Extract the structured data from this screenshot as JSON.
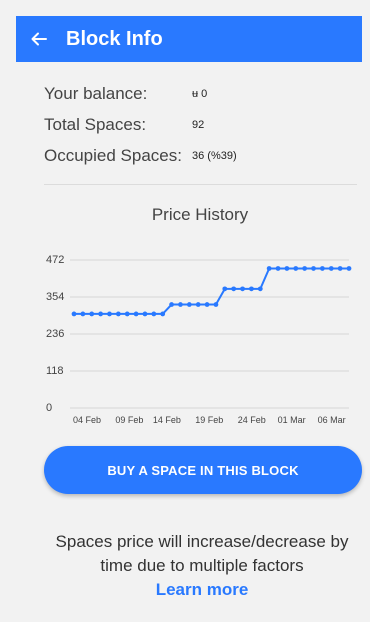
{
  "header": {
    "title": "Block Info",
    "back_icon": "arrow-left-icon"
  },
  "info": {
    "balance_label": "Your balance:",
    "balance_value": "ʉ 0",
    "total_label": "Total Spaces:",
    "total_value": "92",
    "occupied_label": "Occupied Spaces:",
    "occupied_value": "36 (%39)"
  },
  "chart_title": "Price History",
  "chart_data": {
    "type": "line",
    "ylim": [
      0,
      472
    ],
    "yticks": [
      0,
      118,
      236,
      354,
      472
    ],
    "xtick_labels": [
      "04 Feb",
      "09 Feb",
      "14 Feb",
      "19 Feb",
      "24 Feb",
      "01 Mar",
      "06 Mar"
    ],
    "x": [
      0,
      1,
      2,
      3,
      4,
      5,
      6,
      7,
      8,
      9,
      10,
      11,
      12,
      13,
      14,
      15,
      16,
      17,
      18,
      19,
      20,
      21,
      22,
      23,
      24,
      25,
      26,
      27,
      28,
      29,
      30,
      31
    ],
    "values": [
      300,
      300,
      300,
      300,
      300,
      300,
      300,
      300,
      300,
      300,
      300,
      330,
      330,
      330,
      330,
      330,
      330,
      380,
      380,
      380,
      380,
      380,
      445,
      445,
      445,
      445,
      445,
      445,
      445,
      445,
      445,
      445
    ],
    "color": "#2979ff",
    "grid": true
  },
  "buy_button": {
    "label": "BUY A SPACE IN THIS BLOCK"
  },
  "footer": {
    "text": "Spaces price will increase/decrease by time due to multiple factors",
    "learn_more": "Learn more"
  }
}
